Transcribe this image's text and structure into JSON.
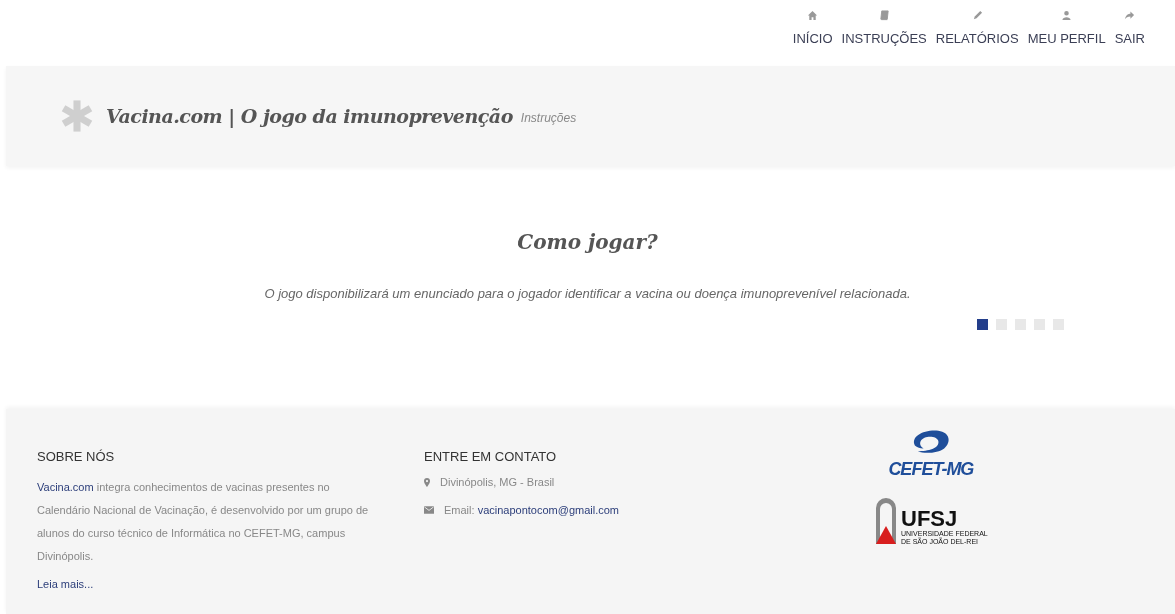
{
  "nav": [
    {
      "label": "INÍCIO"
    },
    {
      "label": "INSTRUÇÕES"
    },
    {
      "label": "RELATÓRIOS"
    },
    {
      "label": "MEU PERFIL"
    },
    {
      "label": "SAIR"
    }
  ],
  "header": {
    "title": "Vacina.com | O jogo da imunoprevenção",
    "subtitle": "Instruções"
  },
  "slide": {
    "heading": "Como jogar?",
    "text": "O jogo disponibilizará um enunciado para o jogador identificar a vacina ou doença imunoprevenível relacionada."
  },
  "dots": [
    {
      "selected": true
    },
    {
      "selected": false
    },
    {
      "selected": false
    },
    {
      "selected": false
    },
    {
      "selected": false
    }
  ],
  "footer": {
    "about": {
      "heading": "SOBRE NÓS",
      "link": "Vacina.com",
      "text": " integra conhecimentos de vacinas presentes no Calendário Nacional de Vacinação, é desenvolvido por um grupo de alunos do curso técnico de Informática no CEFET-MG, campus Divinópolis.",
      "more": "Leia mais..."
    },
    "contact": {
      "heading": "ENTRE EM CONTATO",
      "location": "Divinópolis, MG - Brasil",
      "email_label": "Email: ",
      "email": "vacinapontocom@gmail.com"
    },
    "logos": {
      "cefet": "CEFET-MG",
      "ufsj": "UFSJ",
      "ufsj_line_1": "UNIVERSIDADE FEDERAL",
      "ufsj_line_2": "DE SÃO JOÃO DEL-REI"
    }
  }
}
